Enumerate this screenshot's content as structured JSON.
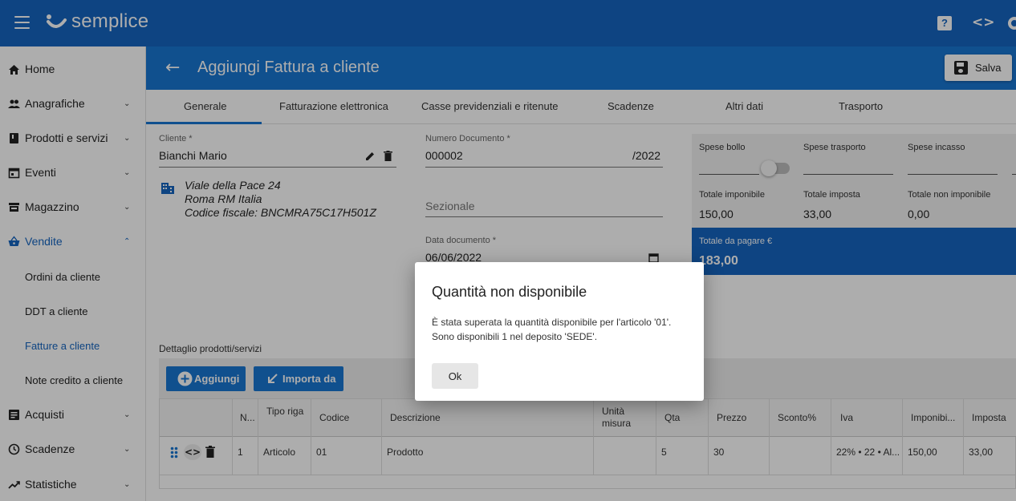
{
  "app": {
    "logo_text": "semplice"
  },
  "sidebar": {
    "items": [
      {
        "label": "Home",
        "icon": "home-icon"
      },
      {
        "label": "Anagrafiche",
        "icon": "people-icon"
      },
      {
        "label": "Prodotti e servizi",
        "icon": "book-icon"
      },
      {
        "label": "Eventi",
        "icon": "calendar-icon"
      },
      {
        "label": "Magazzino",
        "icon": "warehouse-icon"
      },
      {
        "label": "Vendite",
        "icon": "basket-icon"
      },
      {
        "label": "Acquisti",
        "icon": "list-icon"
      },
      {
        "label": "Scadenze",
        "icon": "clock-icon"
      },
      {
        "label": "Statistiche",
        "icon": "trend-icon"
      }
    ],
    "vendite_sub": [
      "Ordini da cliente",
      "DDT a cliente",
      "Fatture a cliente",
      "Note credito a cliente"
    ]
  },
  "header": {
    "title": "Aggiungi Fattura a cliente",
    "save_label": "Salva"
  },
  "tabs": [
    "Generale",
    "Fatturazione elettronica",
    "Casse previdenziali e ritenute",
    "Scadenze",
    "Altri dati",
    "Trasporto"
  ],
  "form": {
    "cliente_label": "Cliente *",
    "cliente_value": "Bianchi Mario",
    "address_line1": "Viale della Pace 24",
    "address_line2": "Roma RM Italia",
    "address_line3": "Codice fiscale: BNCMRA75C17H501Z",
    "numero_label": "Numero Documento *",
    "numero_value": "000002",
    "numero_suffix": "/2022",
    "sezionale_placeholder": "Sezionale",
    "data_label": "Data documento *",
    "data_value": "06/06/2022"
  },
  "summary": {
    "spese_bollo": "Spese bollo",
    "spese_trasporto": "Spese trasporto",
    "spese_incasso": "Spese incasso",
    "totale_imponibile_label": "Totale imponibile",
    "totale_imponibile": "150,00",
    "totale_imposta_label": "Totale imposta",
    "totale_imposta": "33,00",
    "totale_non_imponibile_label": "Totale non imponibile",
    "totale_non_imponibile": "0,00",
    "totale_pagare_label": "Totale da pagare €",
    "totale_pagare": "183,00"
  },
  "products": {
    "section_label": "Dettaglio prodotti/servizi",
    "add_label": "Aggiungi",
    "import_label": "Importa da",
    "columns": [
      "N...",
      "Tipo riga",
      "Codice",
      "Descrizione",
      "Unità misura",
      "Qta",
      "Prezzo",
      "Sconto%",
      "Iva",
      "Imponibi...",
      "Imposta"
    ],
    "rows": [
      {
        "n": "1",
        "tipo": "Articolo",
        "codice": "01",
        "descrizione": "Prodotto",
        "um": "",
        "qta": "5",
        "prezzo": "30",
        "sconto": "",
        "iva": "22% • 22 • Al...",
        "imponibile": "150,00",
        "imposta": "33,00"
      }
    ]
  },
  "dialog": {
    "title": "Quantità non disponibile",
    "message_line1": "È stata superata la quantità disponibile per l'articolo '01'.",
    "message_line2": "Sono disponibili 1 nel deposito 'SEDE'.",
    "ok_label": "Ok"
  }
}
